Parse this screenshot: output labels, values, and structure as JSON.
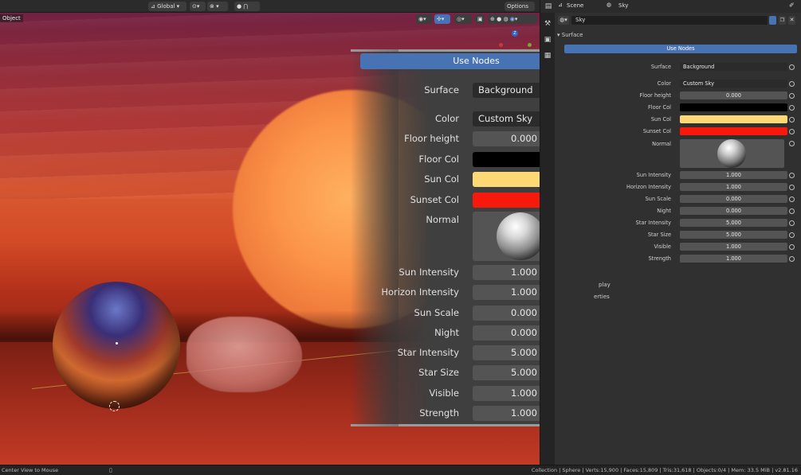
{
  "viewport": {
    "object_label": "Object",
    "header": {
      "transform_orientation": "Global",
      "options_label": "Options"
    },
    "gizmo": {
      "z_label": "Z"
    }
  },
  "zoom_panel": {
    "use_nodes_label": "Use Nodes",
    "surface": {
      "label": "Surface",
      "value": "Background"
    },
    "color": {
      "label": "Color",
      "value": "Custom Sky"
    },
    "floor_height": {
      "label": "Floor height",
      "value": "0.000"
    },
    "floor_col": {
      "label": "Floor Col",
      "color": "#000000"
    },
    "sun_col": {
      "label": "Sun Col",
      "color": "#fcd974"
    },
    "sunset_col": {
      "label": "Sunset Col",
      "color": "#f71a0c"
    },
    "normal": {
      "label": "Normal"
    },
    "sun_intensity": {
      "label": "Sun Intensity",
      "value": "1.000"
    },
    "horizon_intensity": {
      "label": "Horizon Intensity",
      "value": "1.000"
    },
    "sun_scale": {
      "label": "Sun Scale",
      "value": "0.000"
    },
    "night": {
      "label": "Night",
      "value": "0.000"
    },
    "star_intensity": {
      "label": "Star Intensity",
      "value": "5.000"
    },
    "star_size": {
      "label": "Star Size",
      "value": "5.000"
    },
    "visible": {
      "label": "Visible",
      "value": "1.000"
    },
    "strength": {
      "label": "Strength",
      "value": "1.000"
    }
  },
  "properties": {
    "breadcrumb_scene": "Scene",
    "breadcrumb_world": "Sky",
    "world_name": "Sky",
    "surface_section": "Surface",
    "use_nodes_label": "Use Nodes",
    "surface": {
      "label": "Surface",
      "value": "Background"
    },
    "color": {
      "label": "Color",
      "value": "Custom Sky"
    },
    "floor_height": {
      "label": "Floor height",
      "value": "0.000"
    },
    "floor_col": {
      "label": "Floor Col",
      "color": "#000000"
    },
    "sun_col": {
      "label": "Sun Col",
      "color": "#fcd974"
    },
    "sunset_col": {
      "label": "Sunset Col",
      "color": "#f71a0c"
    },
    "normal": {
      "label": "Normal"
    },
    "sun_intensity": {
      "label": "Sun Intensity",
      "value": "1.000"
    },
    "horizon_intensity": {
      "label": "Horizon Intensity",
      "value": "1.000"
    },
    "sun_scale": {
      "label": "Sun Scale",
      "value": "0.000"
    },
    "night": {
      "label": "Night",
      "value": "0.000"
    },
    "star_intensity": {
      "label": "Star Intensity",
      "value": "5.000"
    },
    "star_size": {
      "label": "Star Size",
      "value": "5.000"
    },
    "visible": {
      "label": "Visible",
      "value": "1.000"
    },
    "strength": {
      "label": "Strength",
      "value": "1.000"
    },
    "viewport_display_partial": "play",
    "custom_properties_partial": "erties"
  },
  "statusbar": {
    "left_hint": "Center View to Mouse",
    "right_info": "Collection | Sphere | Verts:15,900 | Faces:15,809 | Tris:31,618 | Objects:0/4 | Mem: 33.5 MiB | v2.81.16"
  }
}
